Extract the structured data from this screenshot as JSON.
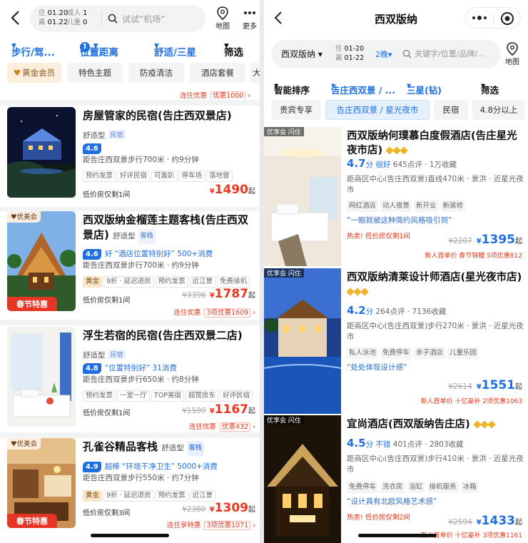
{
  "left": {
    "checkin_label": "住",
    "checkin_date": "01.20",
    "checkout_label": "离",
    "checkout_date": "01.22",
    "adult_label": "成人",
    "adult_count": "1",
    "child_label": "儿童",
    "child_count": "0",
    "search_placeholder": "试试“机场”",
    "map_label": "地图",
    "more_label": "更多",
    "filters": [
      "步行/驾...",
      "位置距离",
      "舒适/三星",
      "筛选"
    ],
    "distance_count": "1",
    "tags": [
      "黄金会员",
      "特色主题",
      "防疫清洁",
      "酒店套餐",
      "大"
    ],
    "top_remnant": {
      "promo1": "连住优惠",
      "promo2": "优惠1000"
    },
    "hotels": [
      {
        "name": "房屋管家的民宿(告庄西双景店)",
        "type": "舒适型",
        "badge": "民宿",
        "score": "4.6",
        "reviews": "",
        "location": "距告庄西双景步行700米 · 约9分钟",
        "chips": [
          "预约发票",
          "好评民宿",
          "可轰趴",
          "停车场",
          "落地窗"
        ],
        "rooms": "低价房仅剩1间",
        "original": "",
        "price": "1490",
        "suffix": "起",
        "promo1": "",
        "promo2": "",
        "ribbon": "",
        "member": ""
      },
      {
        "name": "西双版纳金榴莲主题客栈(告庄西双景店)",
        "type": "舒适型",
        "badge": "客栈",
        "score": "4.6",
        "reviews": "好 “酒店位置特别好” 500+消费",
        "location": "距告庄西双景步行700米 · 约9分钟",
        "chips": [
          "黄金",
          "9折 · 延迟退房",
          "预约发票",
          "近江景",
          "免费接机"
        ],
        "rooms": "低价房仅剩1间",
        "original": "¥3396",
        "price": "1787",
        "suffix": "起",
        "promo1": "连住优惠",
        "promo2": "3项优惠1609",
        "ribbon": "春节特惠",
        "member": "优美会"
      },
      {
        "name": "浮生若宿的民宿(告庄西双景二店)",
        "type": "舒适型",
        "badge": "民宿",
        "score": "4.8",
        "reviews": "“位置特别好” 31消费",
        "location": "距告庄西双景步行650米 · 约8分钟",
        "chips": [
          "预约发票",
          "一室一厅",
          "TOP美宿",
          "超赞房东",
          "好评民宿"
        ],
        "rooms": "低价房仅剩1间",
        "original": "¥1599",
        "price": "1167",
        "suffix": "起",
        "promo1": "连住优惠",
        "promo2": "优惠432",
        "ribbon": "",
        "member": ""
      },
      {
        "name": "孔雀谷精品客栈",
        "type": "舒适型",
        "badge": "客栈",
        "score": "4.9",
        "reviews": "超棒 “环境干净卫生” 5000+消费",
        "location": "距告庄西双景步行550米 · 约7分钟",
        "chips": [
          "黄金",
          "9折 · 延迟退房",
          "预约发票",
          "近江景"
        ],
        "rooms": "低价房仅剩3间",
        "original": "¥2380",
        "price": "1309",
        "suffix": "起",
        "promo1": "连住享特惠",
        "promo2": "3项优惠1071",
        "ribbon": "春节特惠",
        "member": "优美会"
      }
    ]
  },
  "right": {
    "title": "西双版纳",
    "city": "西双版纳",
    "checkin_label": "住",
    "checkin_date": "01-20",
    "checkout_label": "离",
    "checkout_date": "01-22",
    "nights": "2晚",
    "search_placeholder": "关键字/位置/品牌/...",
    "map_label": "地图",
    "filters": [
      "智能排序",
      "告庄西双景 / ...",
      "三星(钻)",
      "筛选"
    ],
    "tags": [
      "贵宾专享",
      "告庄西双景 / 星光夜市",
      "民宿",
      "4.8分以上"
    ],
    "hotels": [
      {
        "name": "西双版纳何璞慕白度假酒店(告庄星光夜市店)",
        "tag_a": "优享会",
        "tag_b": "闪住",
        "score": "4.7",
        "score_unit": "分",
        "score_word": "很好",
        "reviews": "645点评 · 1万收藏",
        "location": "距商区中心(告庄西双景)直线470米 · 景洪 · 近星光夜市",
        "chips": [
          "网红酒店",
          "动人夜景",
          "新开业",
          "新装修"
        ],
        "quote": "“一眼就被这种简约风格吸引到”",
        "hot": "热卖! 低价房仅剩1间",
        "original": "¥2207",
        "price": "1395",
        "suffix": "起",
        "promo": "新人首单价  春节锦鲤  5项优惠812"
      },
      {
        "name": "西双版纳清莱设计师酒店(星光夜市店)",
        "tag_a": "优享会",
        "tag_b": "闪住",
        "score": "4.2",
        "score_unit": "分",
        "score_word": "",
        "reviews": "264点评 · 7136收藏",
        "location": "距商区中心(告庄西双景)步行270米 · 景洪 · 近星光夜市",
        "chips": [
          "私人泳池",
          "免费停车",
          "亲子酒店",
          "儿童乐园"
        ],
        "quote": "“处处体现设计感”",
        "hot": "",
        "original": "¥2614",
        "price": "1551",
        "suffix": "起",
        "promo": "新人首单价  十亿豪补  2项优惠1063"
      },
      {
        "name": "宜尚酒店(西双版纳告庄店)",
        "tag_a": "优享会",
        "tag_b": "闪住",
        "score": "4.5",
        "score_unit": "分",
        "score_word": "不错",
        "reviews": "401点评 · 2803收藏",
        "location": "距商区中心(告庄西双景)步行410米 · 景洪 · 近星光夜市",
        "chips": [
          "免费停车",
          "洗衣房",
          "浴缸",
          "接机服务",
          "冰箱"
        ],
        "quote": "“设计具有北欧风格艺术感”",
        "hot": "热卖! 低价房仅剩2间",
        "original": "¥2594",
        "price": "1433",
        "suffix": "起",
        "promo": "新人首单价  十亿豪补  3项优惠1161"
      }
    ]
  },
  "colors": {
    "accent": "#1f6fe0",
    "price_red": "#e8381e",
    "ribbon": "#e53524",
    "gold": "#f0b429"
  }
}
